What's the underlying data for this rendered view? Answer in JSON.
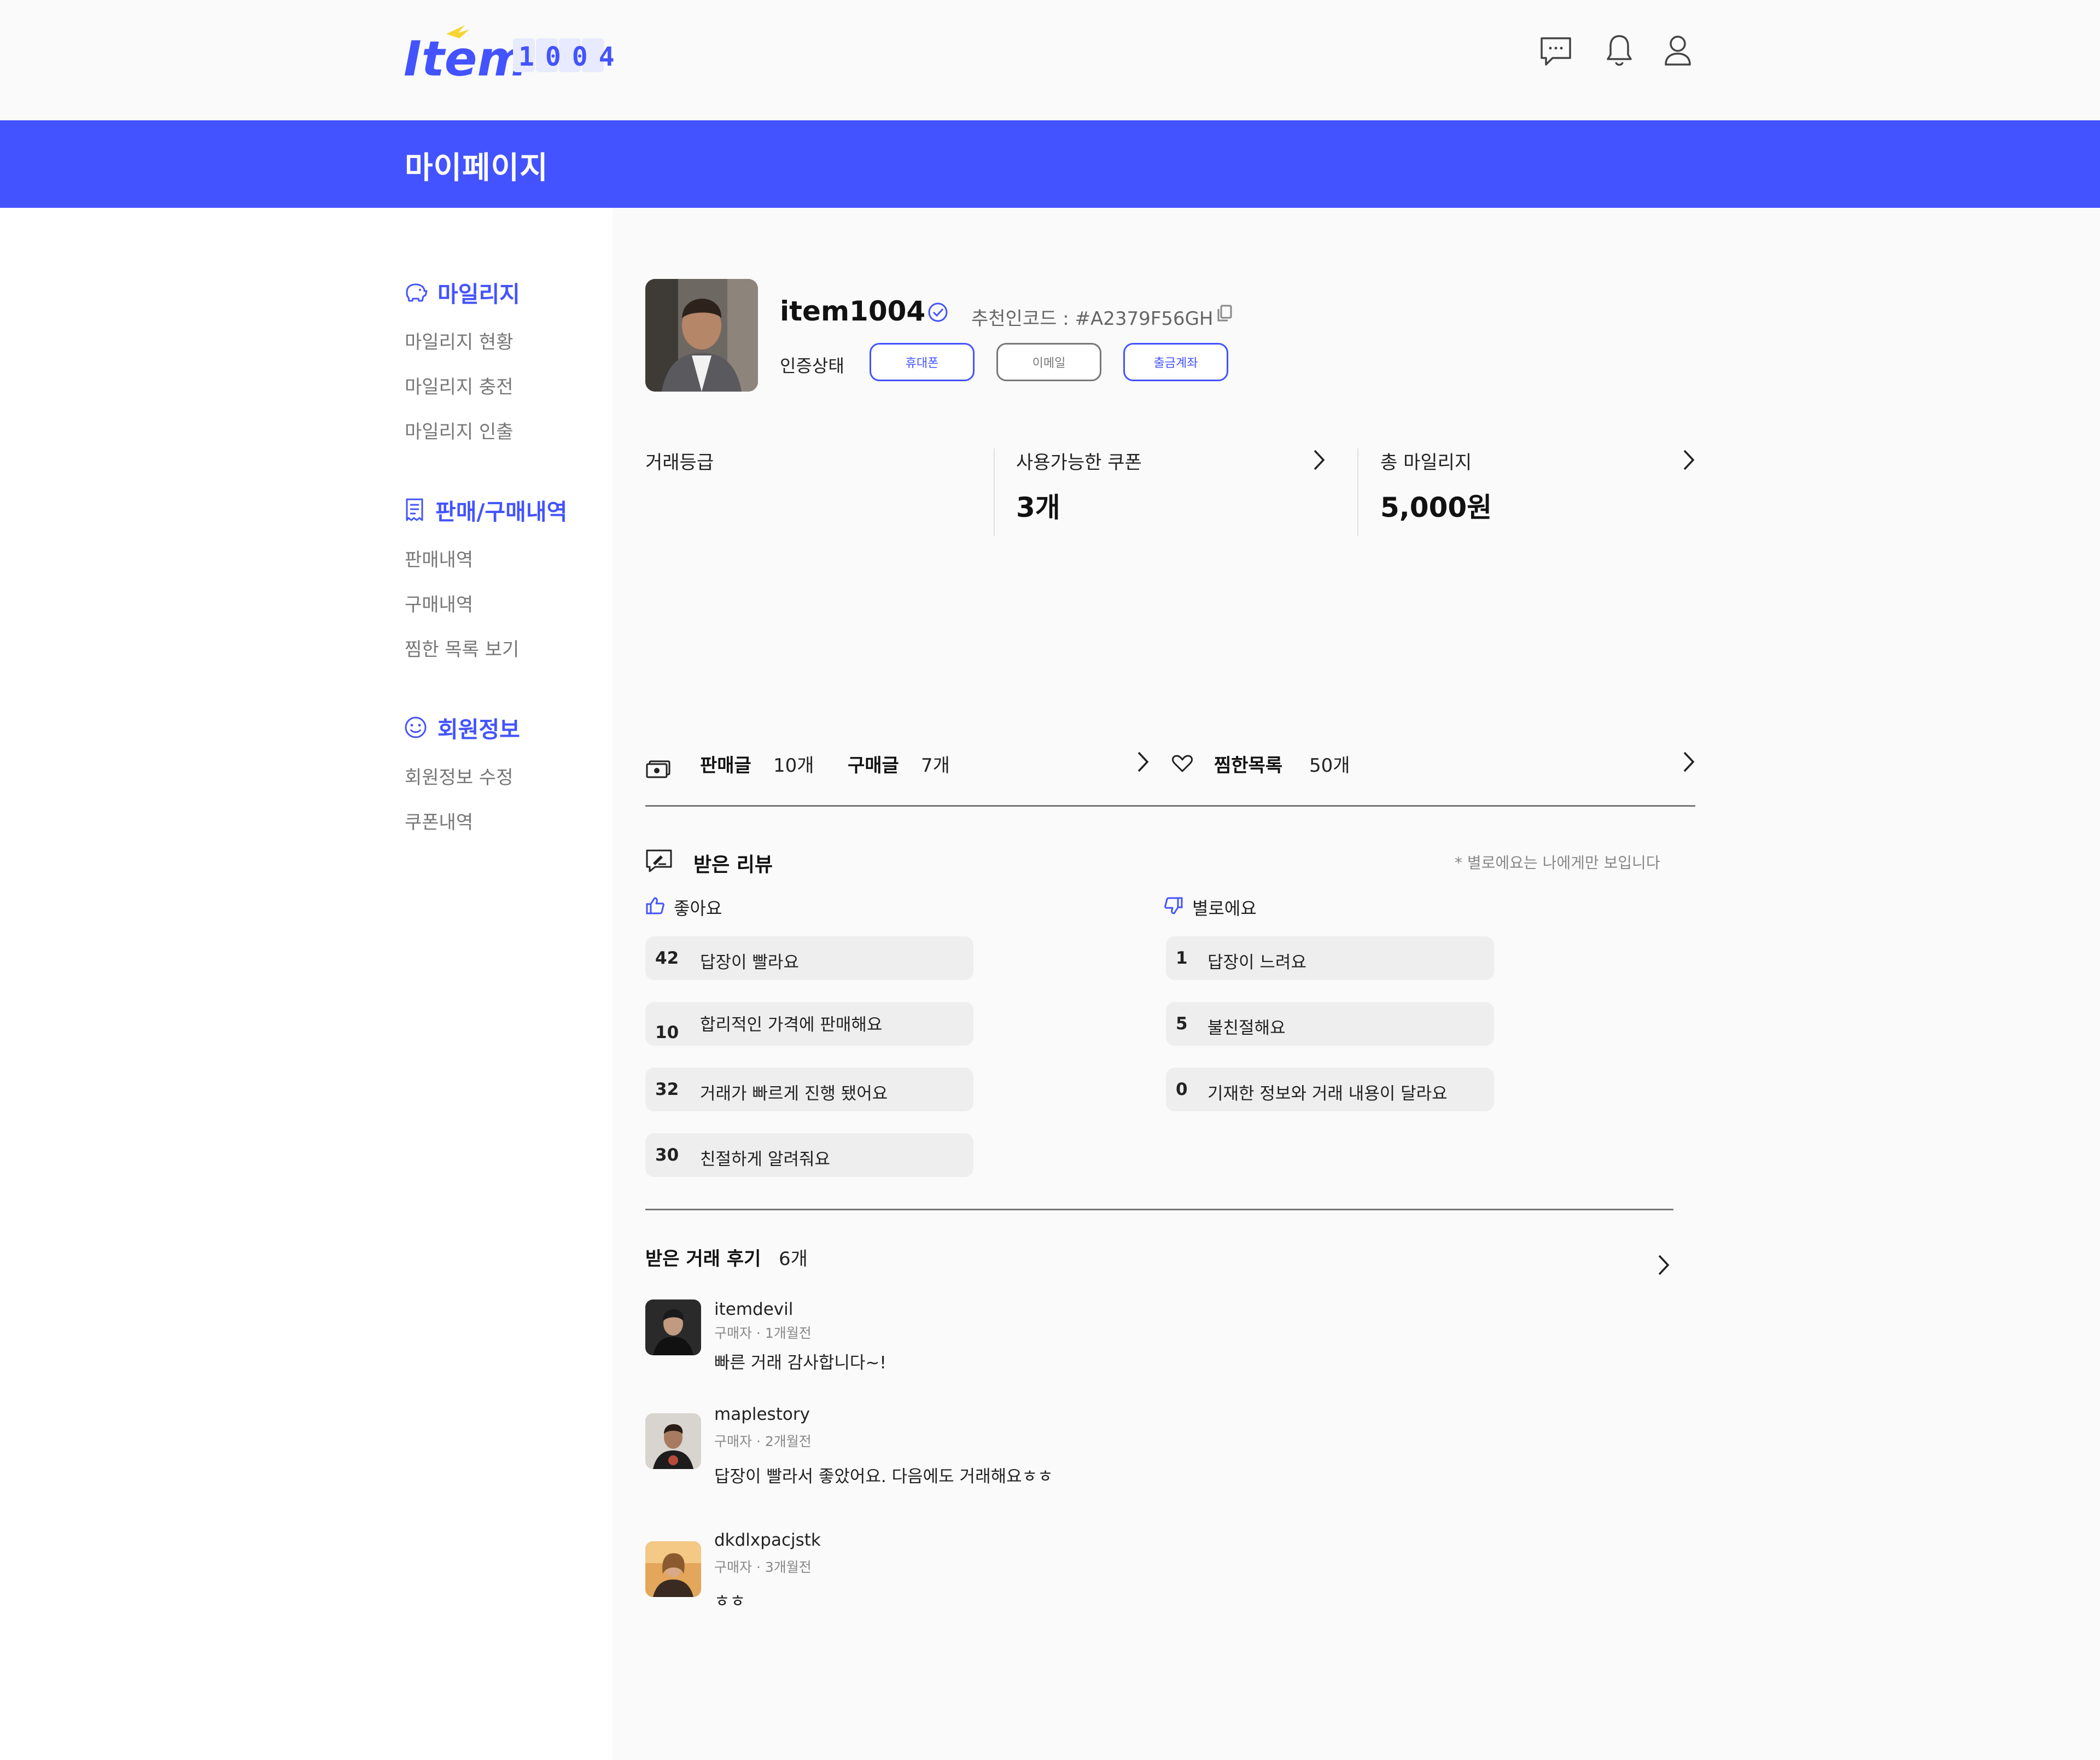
{
  "header": {
    "logo_word": "Item",
    "logo_number": "1004"
  },
  "banner": {
    "title": "마이페이지"
  },
  "sidebar": {
    "sections": [
      {
        "title": "마일리지",
        "icon": "piggy-bank-icon",
        "items": [
          "마일리지 현황",
          "마일리지 충전",
          "마일리지 인출"
        ]
      },
      {
        "title": "판매/구매내역",
        "icon": "receipt-icon",
        "items": [
          "판매내역",
          "구매내역",
          "찜한 목록 보기"
        ]
      },
      {
        "title": "회원정보",
        "icon": "smile-icon",
        "items": [
          "회원정보 수정",
          "쿠폰내역"
        ]
      }
    ]
  },
  "profile": {
    "username": "item1004",
    "referral": "추천인코드 : #A2379F56GH",
    "verify_label": "인증상태",
    "buttons": [
      "휴대폰",
      "이메일",
      "출금계좌"
    ]
  },
  "stats": {
    "grade_label": "거래등급",
    "coupon_label": "사용가능한 쿠폰",
    "coupon_value": "3개",
    "mileage_label": "총 마일리지",
    "mileage_value": "5,000원"
  },
  "activity": {
    "sell_label": "판매글",
    "sell_count": "10개",
    "buy_label": "구매글",
    "buy_count": "7개",
    "wish_label": "찜한목록",
    "wish_count": "50개"
  },
  "reviews": {
    "title": "받은 리뷰",
    "note": "* 별로에요는 나에게만 보입니다",
    "good_label": "좋아요",
    "bad_label": "별로에요",
    "good": [
      {
        "count": "42",
        "text": "답장이 빨라요"
      },
      {
        "count": "10",
        "text": "합리적인 가격에 판매해요"
      },
      {
        "count": "32",
        "text": "거래가 빠르게 진행 됐어요"
      },
      {
        "count": "30",
        "text": "친절하게 알려줘요"
      }
    ],
    "bad": [
      {
        "count": "1",
        "text": "답장이 느려요"
      },
      {
        "count": "5",
        "text": "불친절해요"
      },
      {
        "count": "0",
        "text": "기재한 정보와 거래 내용이 달라요"
      }
    ]
  },
  "trade_reviews": {
    "title": "받은 거래 후기",
    "count": "6개",
    "items": [
      {
        "user": "itemdevil",
        "role": "구매자",
        "time": "1개월전",
        "text": "빠른 거래 감사합니다~!"
      },
      {
        "user": "maplestory",
        "role": "구매자",
        "time": "2개월전",
        "text": "답장이 빨라서 좋았어요. 다음에도 거래해요ㅎㅎ"
      },
      {
        "user": "dkdlxpacjstk",
        "role": "구매자",
        "time": "3개월전",
        "text": "ㅎㅎ"
      }
    ]
  },
  "colors": {
    "accent": "#4353ff",
    "pill": "#eeeeee",
    "muted": "#777777"
  }
}
